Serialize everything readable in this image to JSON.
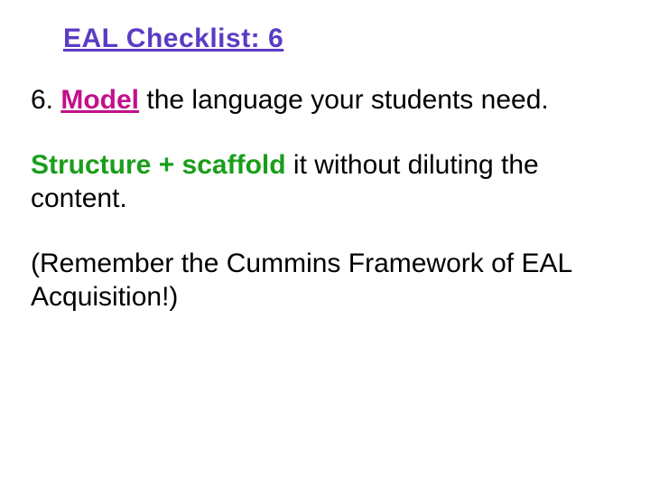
{
  "title": "EAL Checklist: 6",
  "line1": {
    "prefix": "6. ",
    "model": "Model",
    "rest": " the language your students need."
  },
  "line2": {
    "scaffold_part": "Structure + scaffold",
    "rest": " it without diluting the content."
  },
  "line3": "(Remember the Cummins Framework of EAL Acquisition!)"
}
